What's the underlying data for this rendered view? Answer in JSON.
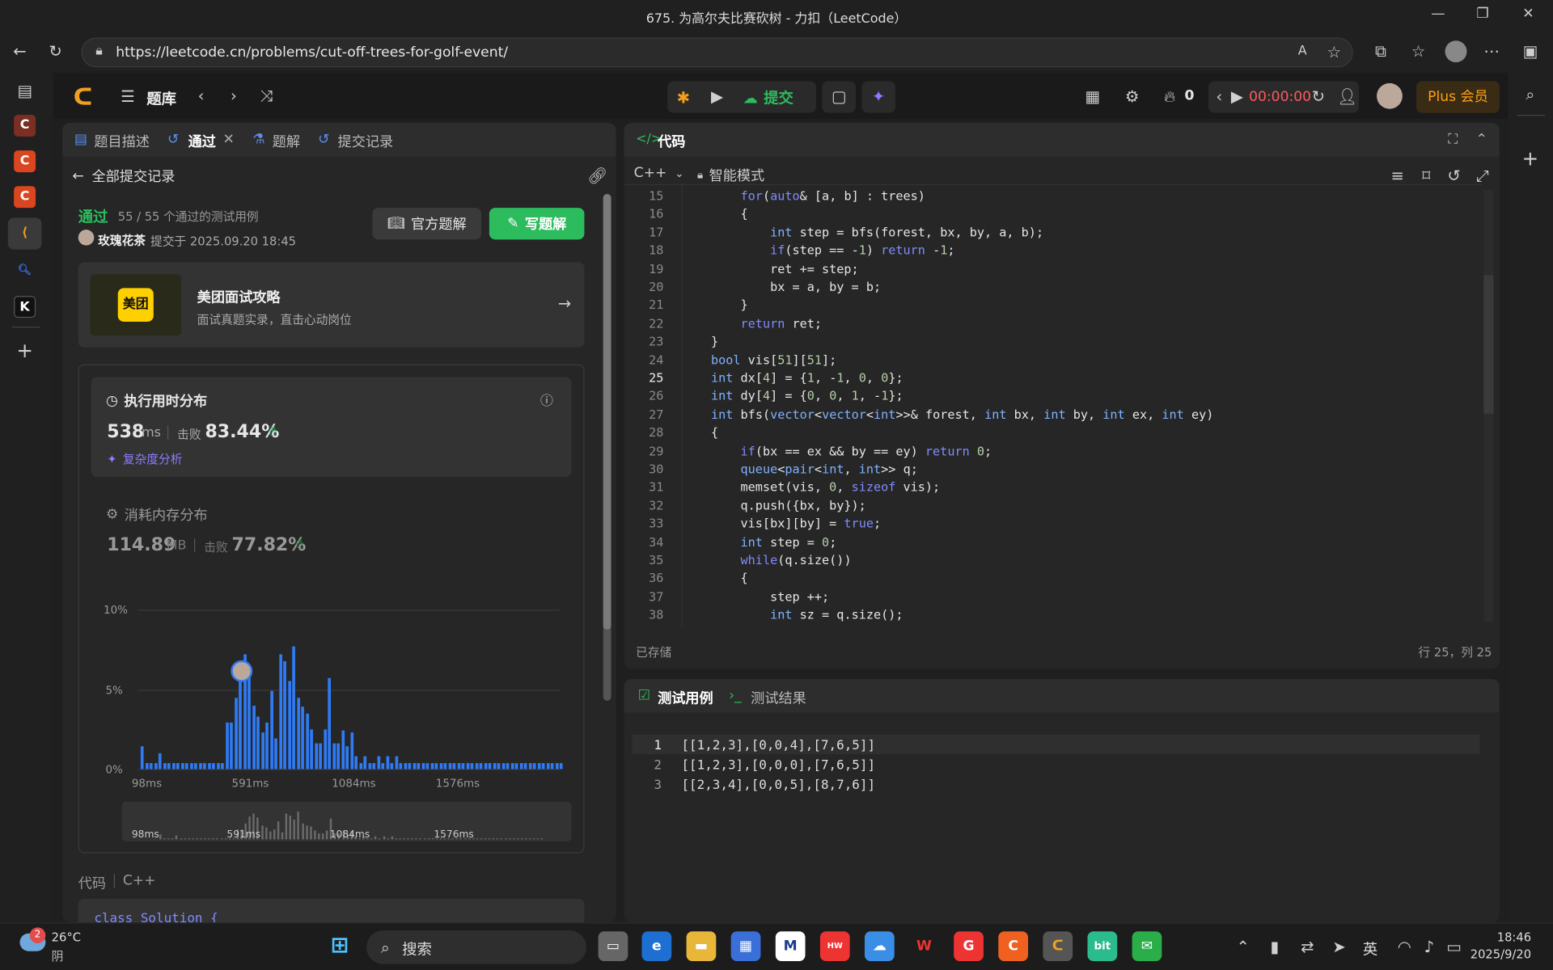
{
  "browser": {
    "title": "675. 为高尔夫比赛砍树 - 力扣（LeetCode）",
    "url": "https://leetcode.cn/problems/cut-off-trees-for-golf-event/"
  },
  "header": {
    "problem_bank": "题库",
    "submit": "提交",
    "streak": "0",
    "timer": "00:00:00",
    "plus": "Plus 会员"
  },
  "left_tabs": {
    "description": "题目描述",
    "passed": "通过",
    "solutions": "题解",
    "submissions": "提交记录"
  },
  "back": {
    "label": "全部提交记录"
  },
  "result": {
    "status": "通过",
    "cases": "55 / 55 个通过的测试用例",
    "user": "玫瑰花茶",
    "submitted": "提交于 2025.09.20 18:45",
    "official_btn": "官方题解",
    "write_btn": "写题解"
  },
  "promo": {
    "logo": "美团",
    "title": "美团面试攻略",
    "subtitle": "面试真题实录，直击心动岗位"
  },
  "runtime": {
    "heading": "执行用时分布",
    "value": "538",
    "unit": "ms",
    "beats_label": "击败",
    "beats": "83.44%",
    "complexity": "复杂度分析"
  },
  "memory": {
    "heading": "消耗内存分布",
    "value": "114.89",
    "unit": "MB",
    "beats_label": "击败",
    "beats": "77.82%"
  },
  "chart_data": {
    "type": "bar",
    "yticks": [
      "10%",
      "5%",
      "0%"
    ],
    "xticks": [
      "98ms",
      "591ms",
      "1084ms",
      "1576ms"
    ],
    "ylim": [
      0,
      10
    ],
    "values": [
      1.4,
      0.4,
      0.4,
      0.4,
      1.0,
      0.4,
      0.4,
      0.4,
      0.4,
      0.4,
      0.4,
      0.4,
      0.4,
      0.4,
      0.4,
      0.4,
      0.4,
      0.4,
      0.4,
      2.9,
      2.9,
      4.5,
      6.4,
      7.2,
      6.1,
      4.0,
      3.3,
      2.3,
      2.9,
      4.9,
      1.9,
      7.2,
      6.8,
      5.5,
      7.7,
      4.5,
      3.9,
      3.5,
      2.5,
      1.6,
      1.6,
      2.5,
      5.7,
      1.6,
      1.6,
      2.4,
      1.4,
      2.3,
      0.8,
      0.4,
      0.8,
      0.4,
      0.4,
      0.8,
      0.4,
      0.8,
      0.4,
      0.8,
      0.4,
      0.4,
      0.4,
      0.4,
      0.4,
      0.4,
      0.4,
      0.4,
      0.4,
      0.4,
      0.4,
      0.4,
      0.4,
      0.4,
      0.4,
      0.4,
      0.4,
      0.4,
      0.4,
      0.4,
      0.4,
      0.4,
      0.4,
      0.4,
      0.4,
      0.4,
      0.4,
      0.4,
      0.4,
      0.4,
      0.4,
      0.4,
      0.4,
      0.4,
      0.4,
      0.4,
      0.4
    ]
  },
  "code_section": {
    "label": "代码",
    "lang": "C++",
    "preview": "class Solution {"
  },
  "editor": {
    "title": "代码",
    "lang": "C++",
    "mode": "智能模式",
    "saved": "已存储",
    "position": "行 25，列 25",
    "lines": [
      {
        "n": "15",
        "t": "        for(auto& [a, b] : trees)"
      },
      {
        "n": "16",
        "t": "        {"
      },
      {
        "n": "17",
        "t": "            int step = bfs(forest, bx, by, a, b);"
      },
      {
        "n": "18",
        "t": "            if(step == -1) return -1;"
      },
      {
        "n": "19",
        "t": "            ret += step;"
      },
      {
        "n": "20",
        "t": "            bx = a, by = b;"
      },
      {
        "n": "21",
        "t": "        }"
      },
      {
        "n": "22",
        "t": "        return ret;"
      },
      {
        "n": "23",
        "t": "    }"
      },
      {
        "n": "24",
        "t": "    bool vis[51][51];"
      },
      {
        "n": "25",
        "t": "    int dx[4] = {1, -1, 0, 0};"
      },
      {
        "n": "26",
        "t": "    int dy[4] = {0, 0, 1, -1};"
      },
      {
        "n": "27",
        "t": "    int bfs(vector<vector<int>>& forest, int bx, int by, int ex, int ey)"
      },
      {
        "n": "28",
        "t": "    {"
      },
      {
        "n": "29",
        "t": "        if(bx == ex && by == ey) return 0;"
      },
      {
        "n": "30",
        "t": "        queue<pair<int, int>> q;"
      },
      {
        "n": "31",
        "t": "        memset(vis, 0, sizeof vis);"
      },
      {
        "n": "32",
        "t": "        q.push({bx, by});"
      },
      {
        "n": "33",
        "t": "        vis[bx][by] = true;"
      },
      {
        "n": "34",
        "t": "        int step = 0;"
      },
      {
        "n": "35",
        "t": "        while(q.size())"
      },
      {
        "n": "36",
        "t": "        {"
      },
      {
        "n": "37",
        "t": "            step ++;"
      },
      {
        "n": "38",
        "t": "            int sz = q.size();"
      }
    ]
  },
  "tests": {
    "tab_cases": "测试用例",
    "tab_results": "测试结果",
    "cases": [
      {
        "n": "1",
        "t": "[[1,2,3],[0,0,4],[7,6,5]]"
      },
      {
        "n": "2",
        "t": "[[1,2,3],[0,0,0],[7,6,5]]"
      },
      {
        "n": "3",
        "t": "[[2,3,4],[0,0,5],[8,7,6]]"
      }
    ]
  },
  "taskbar": {
    "badge": "2",
    "temp": "26°C",
    "weather": "阴",
    "search": "搜索",
    "ime": "英",
    "time": "18:46",
    "date": "2025/9/20"
  }
}
